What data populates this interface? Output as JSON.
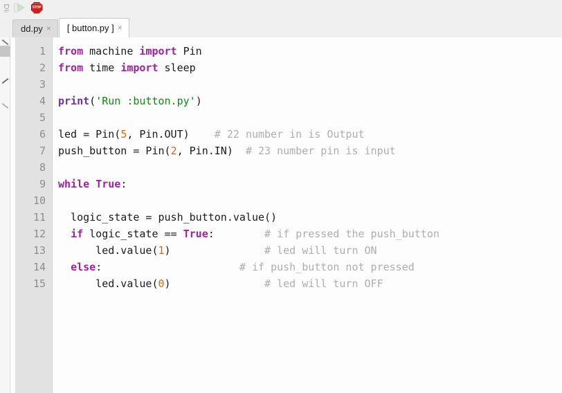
{
  "toolbar": {
    "buttons": [
      {
        "name": "debug-icon",
        "label": "Debug",
        "state": "disabled"
      },
      {
        "name": "run-icon",
        "label": "Run",
        "state": "disabled"
      },
      {
        "name": "stop-icon",
        "label": "Stop",
        "state": "enabled",
        "glyph": "STOP",
        "color": "#cf2020"
      }
    ]
  },
  "tabs": [
    {
      "label": "dd.py",
      "close": "×",
      "active": false
    },
    {
      "label": "[ button.py ]",
      "close": "×",
      "active": true
    }
  ],
  "editor": {
    "background": "#fdfdfd",
    "gutter_background": "#e2e2e2",
    "line_number_color": "#8d8d8d",
    "colors": {
      "keyword": "#a020a0",
      "builtin": "#7030a0",
      "string": "#118811",
      "number": "#d2691e",
      "comment": "#aeaeae",
      "text": "#1a1a1a"
    },
    "line_numbers": [
      1,
      2,
      3,
      4,
      5,
      6,
      7,
      8,
      9,
      10,
      11,
      12,
      13,
      14,
      15
    ],
    "lines": [
      {
        "n": 1,
        "text": "from machine import Pin"
      },
      {
        "n": 2,
        "text": "from time import sleep"
      },
      {
        "n": 3,
        "text": ""
      },
      {
        "n": 4,
        "text": "print('Run :button.py')"
      },
      {
        "n": 5,
        "text": ""
      },
      {
        "n": 6,
        "text": "led = Pin(5, Pin.OUT)      # 22 number in is Output"
      },
      {
        "n": 7,
        "text": "push_button = Pin(2, Pin.IN)  # 23 number pin is input"
      },
      {
        "n": 8,
        "text": ""
      },
      {
        "n": 9,
        "text": "while True:"
      },
      {
        "n": 10,
        "text": ""
      },
      {
        "n": 11,
        "text": "  logic_state = push_button.value()"
      },
      {
        "n": 12,
        "text": "  if logic_state == True:        # if pressed the push_button"
      },
      {
        "n": 13,
        "text": "      led.value(1)              # led will turn ON"
      },
      {
        "n": 14,
        "text": "  else:                        # if push_button not pressed"
      },
      {
        "n": 15,
        "text": "      led.value(0)              # led will turn OFF"
      }
    ],
    "tokens": {
      "l1": {
        "kw1": "from",
        "mod": " machine ",
        "kw2": "import",
        "name": " Pin"
      },
      "l2": {
        "kw1": "from",
        "mod": " time ",
        "kw2": "import",
        "name": " sleep"
      },
      "l4": {
        "fn": "print",
        "open": "(",
        "str": "'Run :button.py'",
        "close": ")"
      },
      "l6": {
        "a": "led = Pin(",
        "num": "5",
        "b": ", Pin.OUT)",
        "pad": "    ",
        "cmt": "# 22 number in is Output"
      },
      "l7": {
        "a": "push_button = Pin(",
        "num": "2",
        "b": ", Pin.IN)",
        "pad": "  ",
        "cmt": "# 23 number pin is input"
      },
      "l9": {
        "kw": "while",
        "sp": " ",
        "val": "True",
        "colon": ":"
      },
      "l11": {
        "a": "  logic_state = push_button.value()"
      },
      "l12": {
        "indent": "  ",
        "kw": "if",
        "a": " logic_state == ",
        "val": "True",
        "colon": ":",
        "pad": "        ",
        "cmt": "# if pressed the push_button"
      },
      "l13": {
        "a": "      led.value(",
        "num": "1",
        "b": ")",
        "pad": "               ",
        "cmt": "# led will turn ON"
      },
      "l14": {
        "indent": "  ",
        "kw": "else",
        "colon": ":",
        "pad": "                      ",
        "cmt": "# if push_button not pressed"
      },
      "l15": {
        "a": "      led.value(",
        "num": "0",
        "b": ")",
        "pad": "               ",
        "cmt": "# led will turn OFF"
      }
    }
  }
}
